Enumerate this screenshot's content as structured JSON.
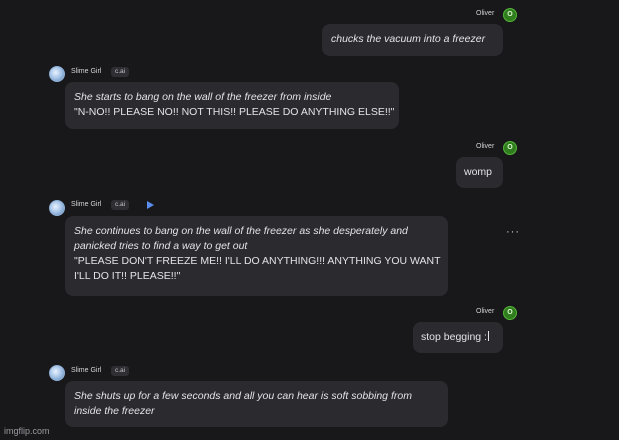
{
  "messages": [
    {
      "author": "Oliver",
      "avatar_letter": "O",
      "lines": [
        {
          "text": "chucks the vacuum into a freezer",
          "style": "italic"
        }
      ]
    },
    {
      "author": "Slime Girl",
      "badge": "c.ai",
      "lines": [
        {
          "text": "She starts to bang on the wall of the freezer from inside",
          "style": "italic"
        },
        {
          "text": "\"N-NO!! PLEASE NO!! NOT THIS!! PLEASE DO ANYTHING ELSE!!\"",
          "style": "normal"
        }
      ]
    },
    {
      "author": "Oliver",
      "avatar_letter": "O",
      "lines": [
        {
          "text": "womp",
          "style": "normal"
        }
      ]
    },
    {
      "author": "Slime Girl",
      "badge": "c.ai",
      "lines": [
        {
          "text": "She continues to bang on the wall of the freezer as she desperately and",
          "style": "italic"
        },
        {
          "text": "panicked tries to find a way to get out",
          "style": "italic"
        },
        {
          "text": "\"PLEASE DON'T FREEZE ME!! I'LL DO ANYTHING!!! ANYTHING YOU WANT",
          "style": "normal"
        },
        {
          "text": "I'LL DO IT!! PLEASE!!\"",
          "style": "normal"
        }
      ]
    },
    {
      "author": "Oliver",
      "avatar_letter": "O",
      "lines": [
        {
          "text": "stop begging :",
          "style": "normal"
        }
      ]
    },
    {
      "author": "Slime Girl",
      "badge": "c.ai",
      "lines": [
        {
          "text": "She shuts up for a few seconds and all you can hear is soft sobbing from",
          "style": "italic"
        },
        {
          "text": "inside the freezer",
          "style": "italic"
        }
      ]
    }
  ],
  "more_options": "···",
  "watermark": "imgflip.com",
  "icons": {
    "play": "play-icon",
    "more": "more-options-icon"
  },
  "colors": {
    "background": "#18181b",
    "bubble": "#2a2a2f",
    "user_avatar": "#2f7d1c",
    "accent": "#5b8def"
  }
}
